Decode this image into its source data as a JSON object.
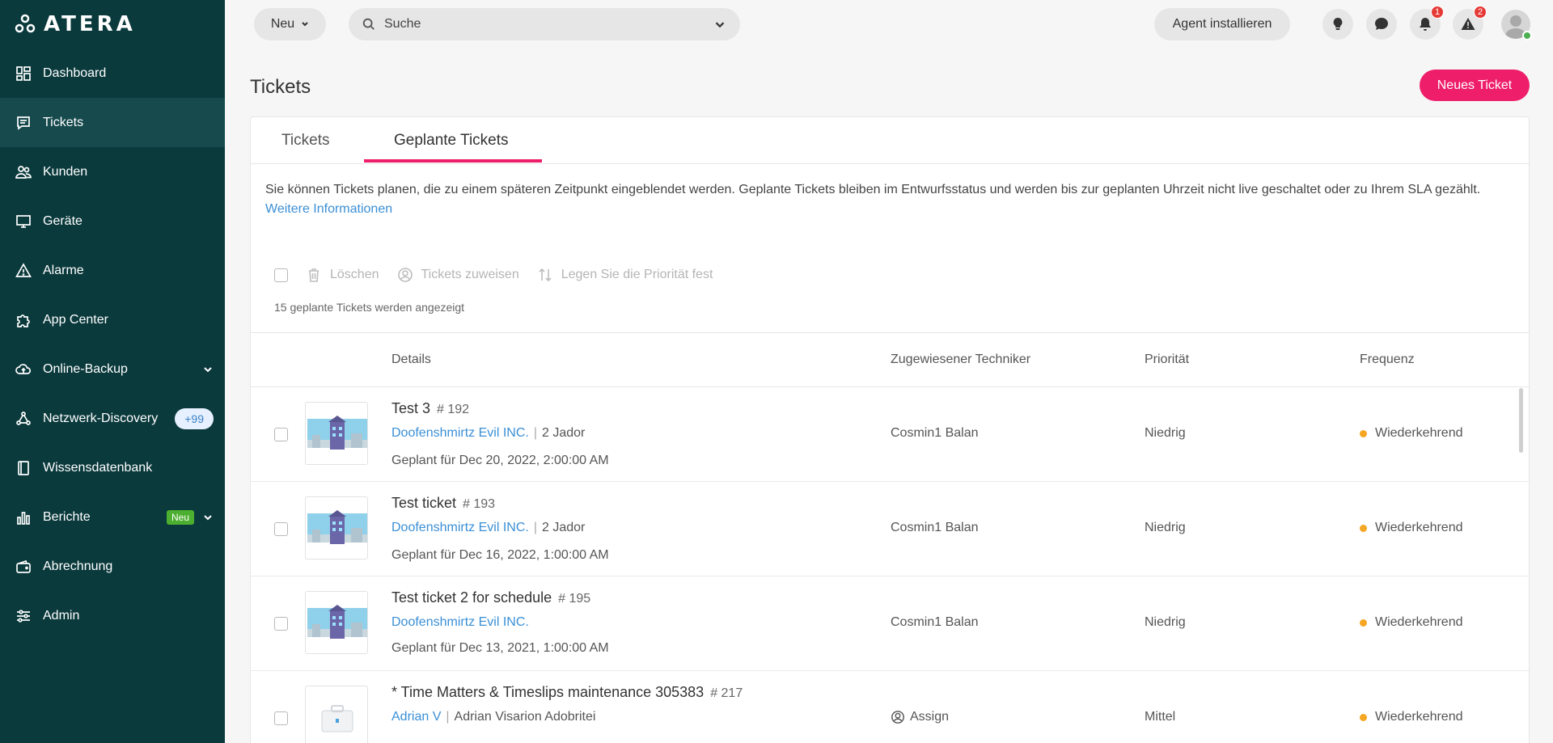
{
  "brand": {
    "logo_text": "ATERA"
  },
  "sidebar": {
    "items": [
      {
        "label": "Dashboard",
        "icon": "dashboard-icon"
      },
      {
        "label": "Tickets",
        "icon": "ticket-icon",
        "active": true
      },
      {
        "label": "Kunden",
        "icon": "users-icon"
      },
      {
        "label": "Geräte",
        "icon": "monitor-icon"
      },
      {
        "label": "Alarme",
        "icon": "alert-icon"
      },
      {
        "label": "App Center",
        "icon": "puzzle-icon"
      },
      {
        "label": "Online-Backup",
        "icon": "cloud-icon"
      },
      {
        "label": "Netzwerk-Discovery",
        "icon": "network-icon",
        "badge": "+99"
      },
      {
        "label": "Wissensdatenbank",
        "icon": "book-icon"
      },
      {
        "label": "Berichte",
        "icon": "chart-icon",
        "badge": "Neu"
      },
      {
        "label": "Abrechnung",
        "icon": "wallet-icon"
      },
      {
        "label": "Admin",
        "icon": "sliders-icon"
      }
    ]
  },
  "topbar": {
    "new_label": "Neu",
    "search_placeholder": "Suche",
    "agent_label": "Agent installieren",
    "notifications_count": "1",
    "alerts_count": "2"
  },
  "page": {
    "title": "Tickets",
    "new_ticket_label": "Neues Ticket"
  },
  "tabs": {
    "tickets": "Tickets",
    "scheduled": "Geplante Tickets"
  },
  "info": {
    "text": "Sie können Tickets planen, die zu einem späteren Zeitpunkt eingeblendet werden. Geplante Tickets bleiben im Entwurfsstatus und werden bis zur geplanten Uhrzeit nicht live geschaltet oder zu Ihrem SLA gezählt.",
    "link": "Weitere Informationen"
  },
  "actions": {
    "delete": "Löschen",
    "assign": "Tickets zuweisen",
    "priority": "Legen Sie die Priorität fest"
  },
  "count_text": "15 geplante Tickets werden angezeigt",
  "columns": {
    "details": "Details",
    "technician": "Zugewiesener Techniker",
    "priority": "Priorität",
    "frequency": "Frequenz"
  },
  "rows": [
    {
      "title": "Test 3",
      "number": "# 192",
      "client": "Doofenshmirtz Evil INC.",
      "contact": "2 Jador",
      "planned": "Geplant für Dec 20, 2022, 2:00:00 AM",
      "technician": "Cosmin1 Balan",
      "priority": "Niedrig",
      "frequency": "Wiederkehrend"
    },
    {
      "title": "Test ticket",
      "number": "# 193",
      "client": "Doofenshmirtz Evil INC.",
      "contact": "2 Jador",
      "planned": "Geplant für Dec 16, 2022, 1:00:00 AM",
      "technician": "Cosmin1 Balan",
      "priority": "Niedrig",
      "frequency": "Wiederkehrend"
    },
    {
      "title": "Test ticket 2 for schedule",
      "number": "# 195",
      "client": "Doofenshmirtz Evil INC.",
      "contact": "",
      "planned": "Geplant für Dec 13, 2021, 1:00:00 AM",
      "technician": "Cosmin1 Balan",
      "priority": "Niedrig",
      "frequency": "Wiederkehrend"
    },
    {
      "title": "* Time Matters & Timeslips maintenance 305383",
      "number": "# 217",
      "client": "Adrian V",
      "contact": "Adrian Visarion Adobritei",
      "planned": "",
      "technician": "Assign",
      "priority": "Mittel",
      "frequency": "Wiederkehrend"
    }
  ],
  "colors": {
    "sidebar": "#0b3a3d",
    "accent": "#ee1e6b",
    "link": "#3a8fd6",
    "freq_dot": "#f5a623"
  }
}
